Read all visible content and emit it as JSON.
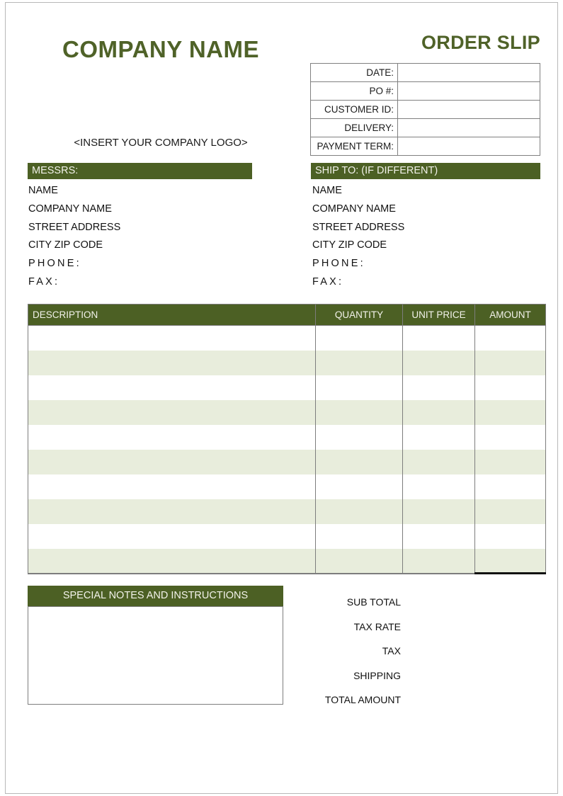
{
  "document": {
    "company_name": "COMPANY NAME",
    "title": "ORDER SLIP",
    "logo_placeholder": "<INSERT YOUR COMPANY LOGO>"
  },
  "colors": {
    "olive": "#4C6024",
    "title_green": "#4F6228",
    "row_alt": "#E8EDDC",
    "border_gray": "#7D7D7D"
  },
  "info_table": {
    "rows": [
      {
        "label": "DATE:",
        "value": ""
      },
      {
        "label": "PO #:",
        "value": ""
      },
      {
        "label": "CUSTOMER ID:",
        "value": ""
      },
      {
        "label": "DELIVERY:",
        "value": ""
      },
      {
        "label": "PAYMENT TERM:",
        "value": ""
      }
    ]
  },
  "messrs": {
    "heading": "MESSRS:",
    "lines": [
      "NAME",
      "COMPANY NAME",
      "STREET ADDRESS",
      "CITY ZIP CODE",
      "PHONE:",
      "FAX:"
    ]
  },
  "ship_to": {
    "heading": "SHIP TO: (IF DIFFERENT)",
    "lines": [
      "NAME",
      "COMPANY NAME",
      "STREET ADDRESS",
      "CITY ZIP CODE",
      "PHONE:",
      "FAX:"
    ]
  },
  "items_table": {
    "headers": {
      "description": "DESCRIPTION",
      "quantity": "QUANTITY",
      "unit_price": "UNIT PRICE",
      "amount": "AMOUNT"
    },
    "rows": [
      {
        "description": "",
        "quantity": "",
        "unit_price": "",
        "amount": ""
      },
      {
        "description": "",
        "quantity": "",
        "unit_price": "",
        "amount": ""
      },
      {
        "description": "",
        "quantity": "",
        "unit_price": "",
        "amount": ""
      },
      {
        "description": "",
        "quantity": "",
        "unit_price": "",
        "amount": ""
      },
      {
        "description": "",
        "quantity": "",
        "unit_price": "",
        "amount": ""
      },
      {
        "description": "",
        "quantity": "",
        "unit_price": "",
        "amount": ""
      },
      {
        "description": "",
        "quantity": "",
        "unit_price": "",
        "amount": ""
      },
      {
        "description": "",
        "quantity": "",
        "unit_price": "",
        "amount": ""
      },
      {
        "description": "",
        "quantity": "",
        "unit_price": "",
        "amount": ""
      },
      {
        "description": "",
        "quantity": "",
        "unit_price": "",
        "amount": ""
      }
    ]
  },
  "notes": {
    "heading": "SPECIAL NOTES AND INSTRUCTIONS",
    "body": ""
  },
  "totals": {
    "rows": [
      {
        "label": "SUB TOTAL",
        "value": ""
      },
      {
        "label": "TAX RATE",
        "value": ""
      },
      {
        "label": "TAX",
        "value": ""
      },
      {
        "label": "SHIPPING",
        "value": ""
      },
      {
        "label": "TOTAL AMOUNT",
        "value": ""
      }
    ]
  }
}
